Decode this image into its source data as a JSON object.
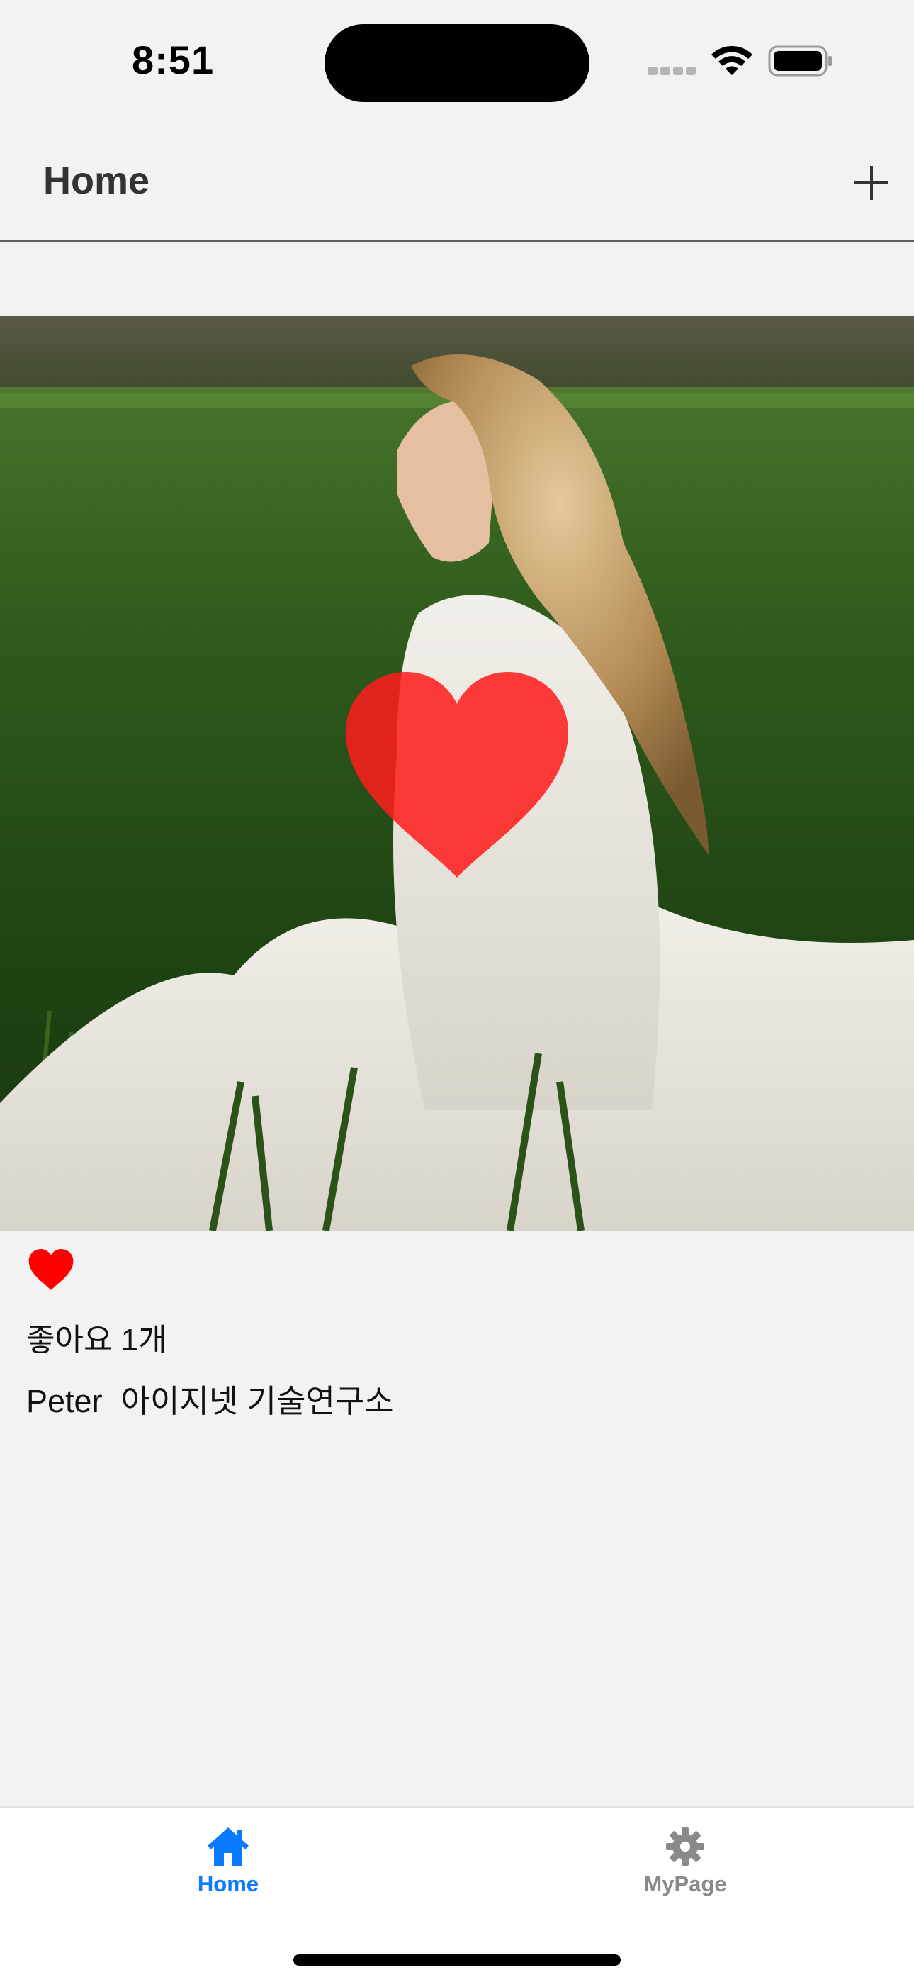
{
  "status_bar": {
    "time": "8:51",
    "icons": [
      "cellular-signal-icon",
      "wifi-icon",
      "battery-icon"
    ]
  },
  "nav": {
    "title": "Home",
    "add_icon": "plus-icon"
  },
  "post": {
    "image_alt": "woman in white lace dress sitting in a green grass field",
    "overlay_icon": "heart-icon",
    "like_icon": "heart-filled-icon",
    "likes_text": "좋아요 1개",
    "author": "Peter",
    "caption": "아이지넷 기술연구소"
  },
  "tabs": [
    {
      "label": "Home",
      "icon": "house-icon",
      "selected": true
    },
    {
      "label": "MyPage",
      "icon": "gear-icon",
      "selected": false
    }
  ],
  "colors": {
    "accent": "#0a7aff",
    "heart": "#ff0000",
    "background": "#f2f2f2",
    "inactive_tab": "#8a8a8a"
  }
}
